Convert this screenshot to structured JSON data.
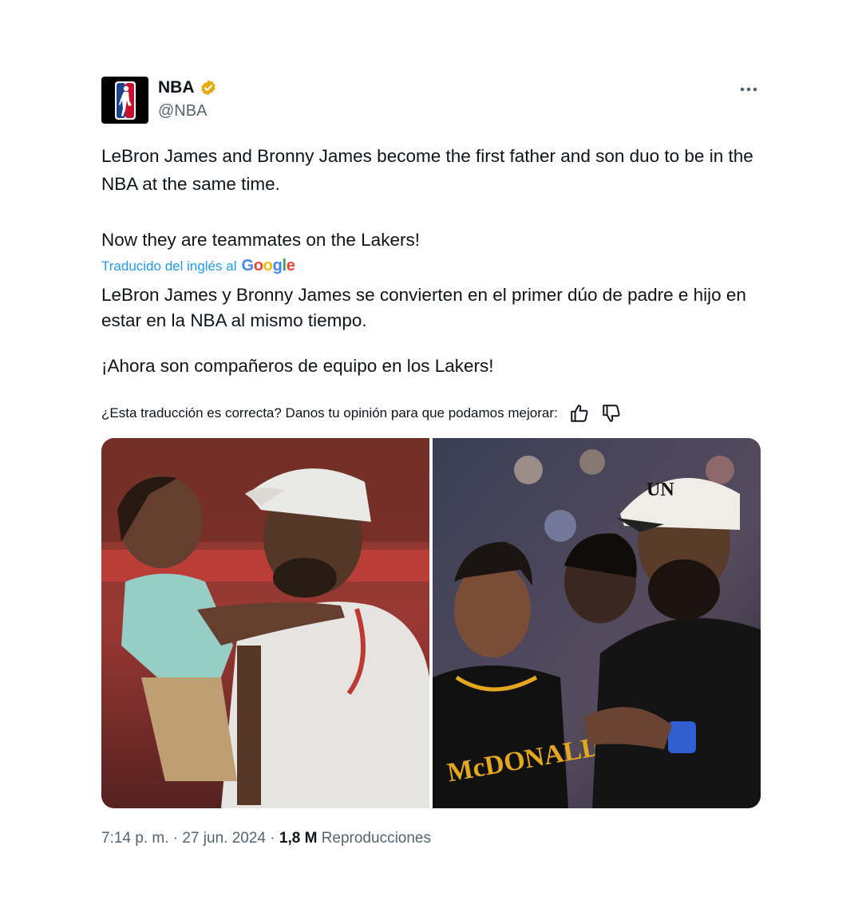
{
  "account": {
    "display_name": "NBA",
    "handle": "@NBA",
    "verified_color": "#e8a913",
    "avatar_icon": "nba-logo-icon"
  },
  "tweet": {
    "original_paragraph_1": "LeBron James and Bronny James become the first father and son duo to be in the NBA at the same time.",
    "original_paragraph_2": "Now they are teammates on the Lakers!",
    "translated_by_label": "Traducido del inglés al",
    "translated_by_brand": "Google",
    "translated_paragraph_1": "LeBron James y Bronny James se convierten en el primer dúo de padre e hijo en estar en la NBA al mismo tiempo.",
    "translated_paragraph_2": "¡Ahora son compañeros de equipo en los Lakers!",
    "feedback_prompt": "¿Esta traducción es correcta? Danos tu opinión para que podamos mejorar:"
  },
  "footer": {
    "time": "7:14 p. m.",
    "separator": "·",
    "date": "27 jun. 2024",
    "views_count": "1,8 M",
    "views_label": "Reproducciones"
  },
  "colors": {
    "text": "#0f1419",
    "secondary": "#536471",
    "link": "#1d9bf0"
  }
}
